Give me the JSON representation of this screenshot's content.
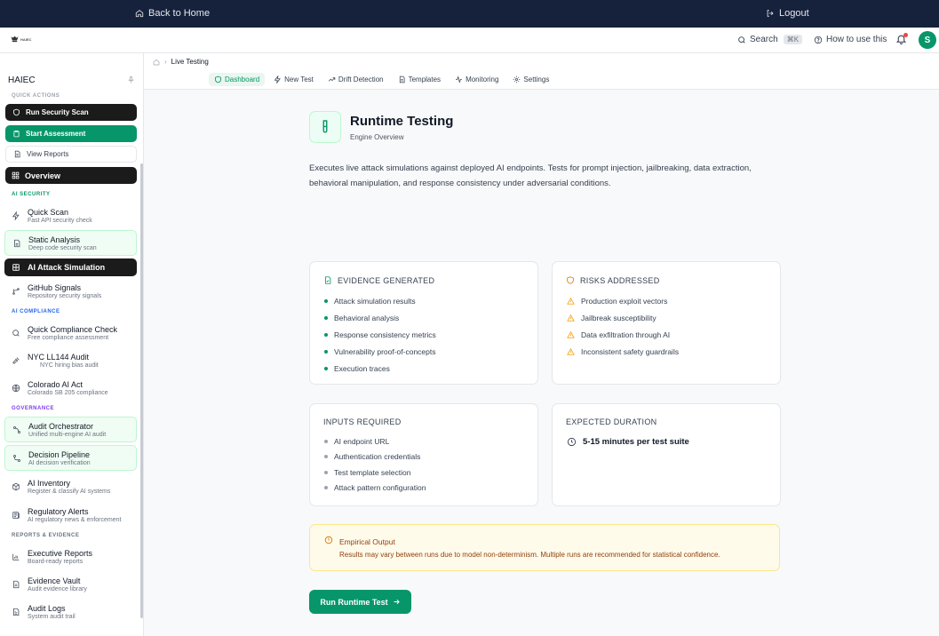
{
  "topbar": {
    "back_label": "Back to Home",
    "logout_label": "Logout"
  },
  "header": {
    "logo_text": "HAIEC",
    "search_label": "Search",
    "search_shortcut": "⌘K",
    "howto_label": "How to use this",
    "avatar_initial": "S"
  },
  "sidebar": {
    "title": "HAIEC",
    "quick_actions_heading": "QUICK ACTIONS",
    "quick_actions": [
      {
        "label": "Run Security Scan"
      },
      {
        "label": "Start Assessment"
      },
      {
        "label": "View Reports"
      }
    ],
    "overview_label": "Overview",
    "sections": [
      {
        "heading": "AI SECURITY",
        "color": "#079669"
      },
      {
        "heading": "AI COMPLIANCE",
        "color": "#2563eb"
      },
      {
        "heading": "GOVERNANCE",
        "color": "#7c3aed"
      },
      {
        "heading": "REPORTS & EVIDENCE",
        "color": "#6b7280"
      }
    ],
    "items": [
      {
        "title": "Quick Scan",
        "subtitle": "Fast API security check"
      },
      {
        "title": "Static Analysis",
        "subtitle": "Deep code security scan"
      },
      {
        "title": "AI Attack Simulation",
        "subtitle": ""
      },
      {
        "title": "GitHub Signals",
        "subtitle": "Repository security signals"
      },
      {
        "title": "Quick Compliance Check",
        "subtitle": "Free compliance assessment"
      },
      {
        "title": "NYC LL144 Audit",
        "subtitle": "NYC hiring bias audit"
      },
      {
        "title": "Colorado AI Act",
        "subtitle": "Colorado SB 205 compliance"
      },
      {
        "title": "Audit Orchestrator",
        "subtitle": "Unified multi-engine AI audit"
      },
      {
        "title": "Decision Pipeline",
        "subtitle": "AI decision verification"
      },
      {
        "title": "AI Inventory",
        "subtitle": "Register & classify AI systems"
      },
      {
        "title": "Regulatory Alerts",
        "subtitle": "AI regulatory news & enforcement"
      },
      {
        "title": "Executive Reports",
        "subtitle": "Board-ready reports"
      },
      {
        "title": "Evidence Vault",
        "subtitle": "Audit evidence library"
      },
      {
        "title": "Audit Logs",
        "subtitle": "System audit trail"
      }
    ]
  },
  "breadcrumb": {
    "current": "Live Testing"
  },
  "tabs": [
    {
      "label": "Dashboard"
    },
    {
      "label": "New Test"
    },
    {
      "label": "Drift Detection"
    },
    {
      "label": "Templates"
    },
    {
      "label": "Monitoring"
    },
    {
      "label": "Settings"
    }
  ],
  "engine": {
    "title": "Runtime Testing",
    "subtitle": "Engine Overview",
    "description": "Executes live attack simulations against deployed AI endpoints. Tests for prompt injection, jailbreaking, data extraction, behavioral manipulation, and response consistency under adversarial conditions."
  },
  "cards": {
    "evidence": {
      "heading": "EVIDENCE GENERATED",
      "items": [
        "Attack simulation results",
        "Behavioral analysis",
        "Response consistency metrics",
        "Vulnerability proof-of-concepts",
        "Execution traces"
      ]
    },
    "risks": {
      "heading": "RISKS ADDRESSED",
      "items": [
        "Production exploit vectors",
        "Jailbreak susceptibility",
        "Data exfiltration through AI",
        "Inconsistent safety guardrails"
      ]
    },
    "inputs": {
      "heading": "INPUTS REQUIRED",
      "items": [
        "AI endpoint URL",
        "Authentication credentials",
        "Test template selection",
        "Attack pattern configuration"
      ]
    },
    "duration": {
      "heading": "EXPECTED DURATION",
      "value": "5-15 minutes per test suite"
    }
  },
  "alert": {
    "title": "Empirical Output",
    "text": "Results may vary between runs due to model non-determinism. Multiple runs are recommended for statistical confidence."
  },
  "run_button": {
    "label": "Run Runtime Test"
  },
  "colors": {
    "accent": "#079669",
    "topbar": "#16213c",
    "warning": "#f59e0b"
  }
}
